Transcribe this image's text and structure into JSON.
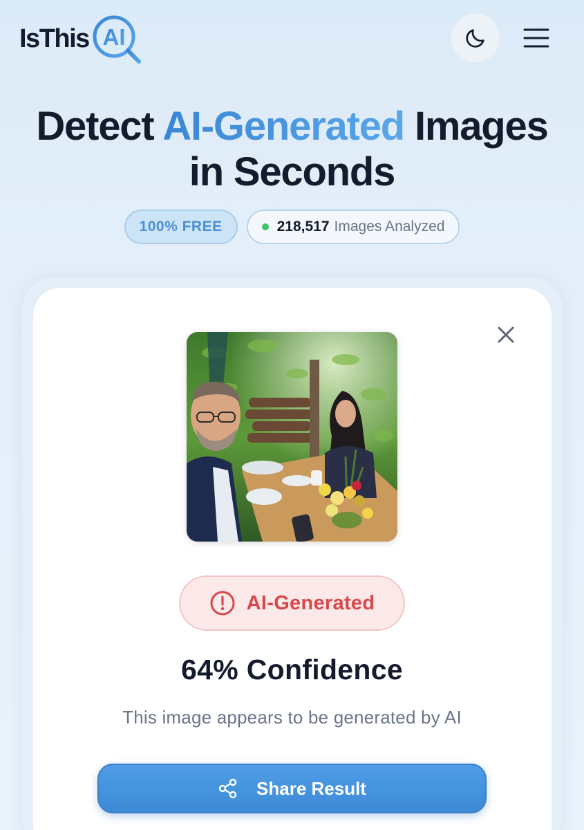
{
  "brand": {
    "name_text": "IsThis",
    "name_mark": "AI"
  },
  "header": {
    "theme_icon": "moon-icon",
    "menu_icon": "hamburger-menu-icon"
  },
  "hero": {
    "title_before": "Detect ",
    "title_accent": "AI-Generated",
    "title_after": " Images",
    "title_line2": "in Seconds"
  },
  "badges": {
    "free_label": "100% FREE",
    "count_value": "218,517",
    "count_label": "Images Analyzed",
    "status_color": "#3ec46d"
  },
  "result": {
    "close_icon": "close-icon",
    "photo_alt": "Selfie of a man and a woman at an outdoor restaurant table with flowers",
    "verdict_icon": "alert-circle-icon",
    "verdict_label": "AI-Generated",
    "verdict_color": "#d8474a",
    "confidence": "64% Confidence",
    "confidence_value": 64,
    "description": "This image appears to be generated by AI",
    "share_label": "Share Result",
    "share_icon": "share-icon"
  },
  "colors": {
    "accent": "#3a86d6",
    "text_dark": "#141b2d",
    "text_muted": "#6b7488"
  }
}
